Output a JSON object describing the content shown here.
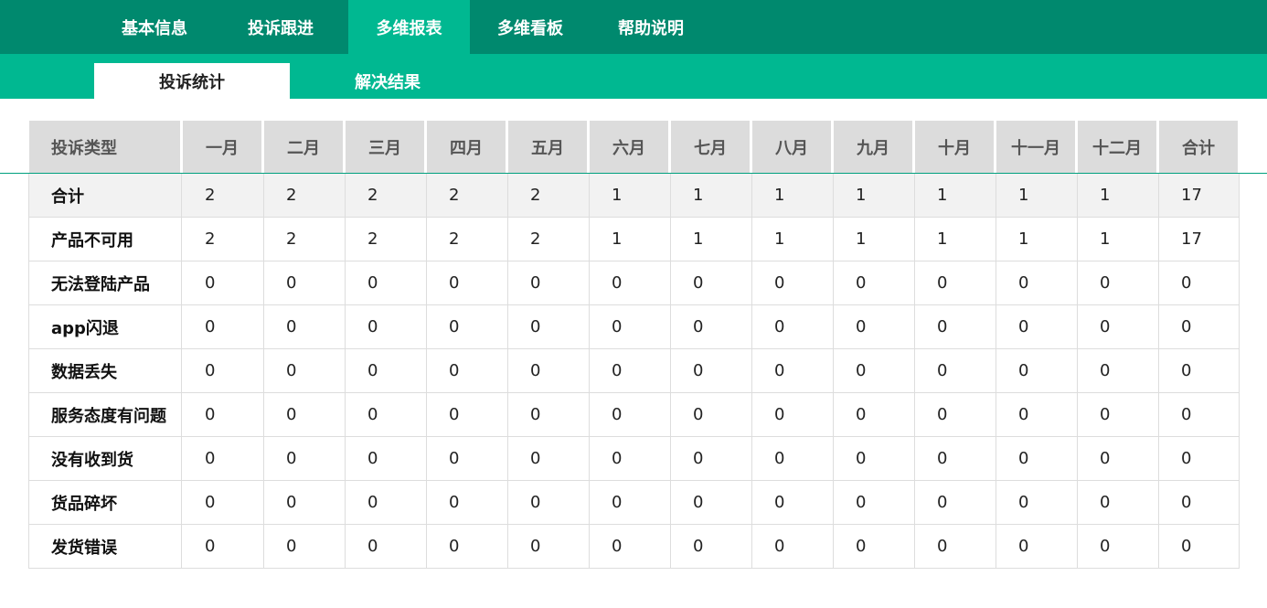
{
  "top_tabs": [
    "基本信息",
    "投诉跟进",
    "多维报表",
    "多维看板",
    "帮助说明"
  ],
  "active_top_tab": "多维报表",
  "sub_tabs": [
    "投诉统计",
    "解决结果"
  ],
  "active_sub_tab": "投诉统计",
  "table": {
    "headers": [
      "投诉类型",
      "一月",
      "二月",
      "三月",
      "四月",
      "五月",
      "六月",
      "七月",
      "八月",
      "九月",
      "十月",
      "十一月",
      "十二月",
      "合计"
    ],
    "rows": [
      {
        "label": "合计",
        "values": [
          "2",
          "2",
          "2",
          "2",
          "2",
          "1",
          "1",
          "1",
          "1",
          "1",
          "1",
          "1",
          "17"
        ]
      },
      {
        "label": "产品不可用",
        "values": [
          "2",
          "2",
          "2",
          "2",
          "2",
          "1",
          "1",
          "1",
          "1",
          "1",
          "1",
          "1",
          "17"
        ]
      },
      {
        "label": "无法登陆产品",
        "values": [
          "0",
          "0",
          "0",
          "0",
          "0",
          "0",
          "0",
          "0",
          "0",
          "0",
          "0",
          "0",
          "0"
        ]
      },
      {
        "label": "app闪退",
        "values": [
          "0",
          "0",
          "0",
          "0",
          "0",
          "0",
          "0",
          "0",
          "0",
          "0",
          "0",
          "0",
          "0"
        ]
      },
      {
        "label": "数据丢失",
        "values": [
          "0",
          "0",
          "0",
          "0",
          "0",
          "0",
          "0",
          "0",
          "0",
          "0",
          "0",
          "0",
          "0"
        ]
      },
      {
        "label": "服务态度有问题",
        "values": [
          "0",
          "0",
          "0",
          "0",
          "0",
          "0",
          "0",
          "0",
          "0",
          "0",
          "0",
          "0",
          "0"
        ]
      },
      {
        "label": "没有收到货",
        "values": [
          "0",
          "0",
          "0",
          "0",
          "0",
          "0",
          "0",
          "0",
          "0",
          "0",
          "0",
          "0",
          "0"
        ]
      },
      {
        "label": "货品碎坏",
        "values": [
          "0",
          "0",
          "0",
          "0",
          "0",
          "0",
          "0",
          "0",
          "0",
          "0",
          "0",
          "0",
          "0"
        ]
      },
      {
        "label": "发货错误",
        "values": [
          "0",
          "0",
          "0",
          "0",
          "0",
          "0",
          "0",
          "0",
          "0",
          "0",
          "0",
          "0",
          "0"
        ]
      }
    ]
  },
  "colors": {
    "nav_dark": "#00896e",
    "nav_light": "#00b891",
    "header_bg": "#dcdcdc"
  }
}
